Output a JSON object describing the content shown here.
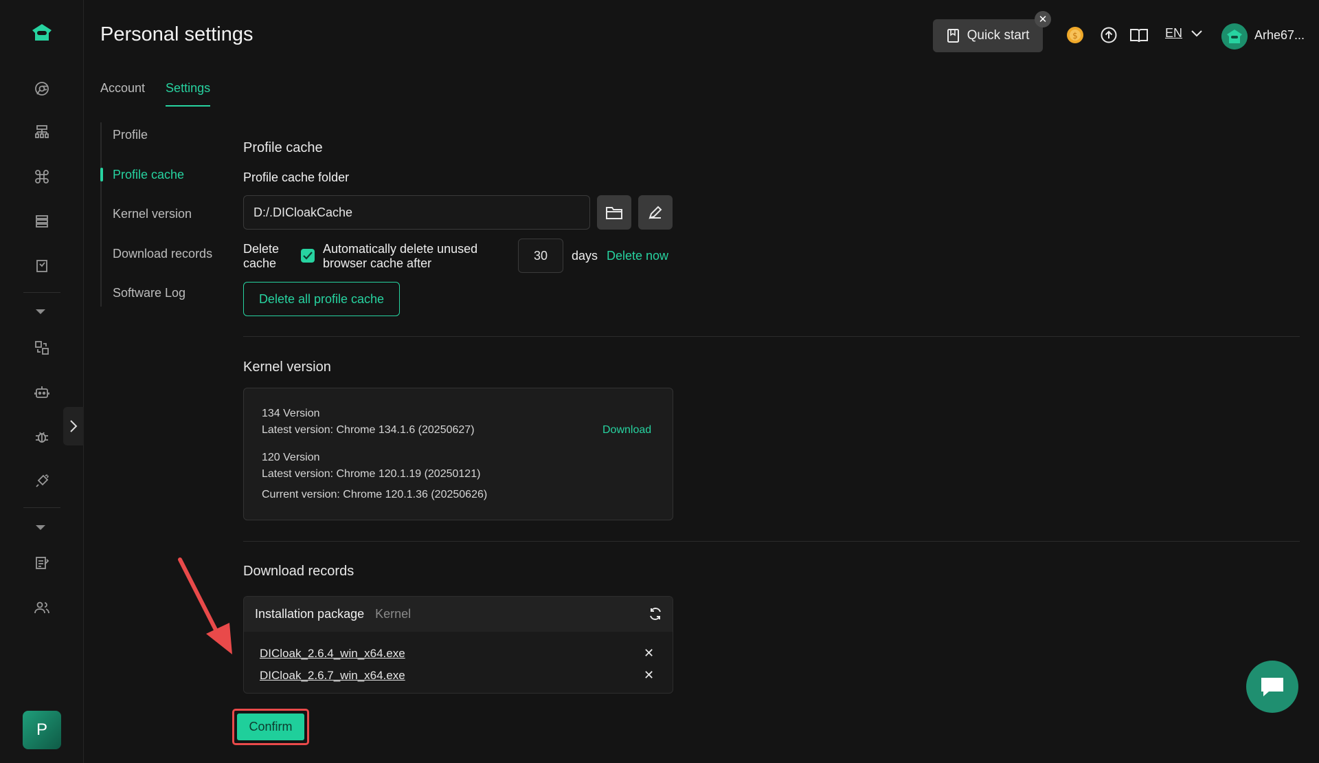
{
  "header": {
    "title": "Personal settings",
    "quick_start": "Quick start",
    "lang": "EN",
    "username": "Arhe67..."
  },
  "tabs": [
    {
      "label": "Account",
      "active": false
    },
    {
      "label": "Settings",
      "active": true
    }
  ],
  "settings_nav": [
    {
      "label": "Profile",
      "active": false
    },
    {
      "label": "Profile cache",
      "active": true
    },
    {
      "label": "Kernel version",
      "active": false
    },
    {
      "label": "Download records",
      "active": false
    },
    {
      "label": "Software Log",
      "active": false
    }
  ],
  "profile_cache": {
    "section_title": "Profile cache",
    "folder_label": "Profile cache folder",
    "folder_value": "D:/.DICloakCache",
    "delete_label": "Delete cache",
    "auto_delete_label": "Automatically delete unused browser cache after",
    "auto_delete_checked": true,
    "days_value": "30",
    "days_unit": "days",
    "delete_now": "Delete now",
    "delete_all": "Delete all profile cache"
  },
  "kernel_version": {
    "section_title": "Kernel version",
    "v134_title": "134 Version",
    "v134_latest": "Latest version: Chrome 134.1.6 (20250627)",
    "v134_action": "Download",
    "v120_title": "120 Version",
    "v120_latest": "Latest version: Chrome 120.1.19 (20250121)",
    "v120_current": "Current version: Chrome 120.1.36 (20250626)"
  },
  "download_records": {
    "section_title": "Download records",
    "tab_installation": "Installation package",
    "tab_kernel": "Kernel",
    "files": [
      "DICloak_2.6.4_win_x64.exe",
      "DICloak_2.6.7_win_x64.exe"
    ]
  },
  "confirm_label": "Confirm",
  "avatar_letter": "P",
  "colors": {
    "accent": "#27d3a0",
    "highlight": "#e94a4a",
    "background": "#141414"
  }
}
